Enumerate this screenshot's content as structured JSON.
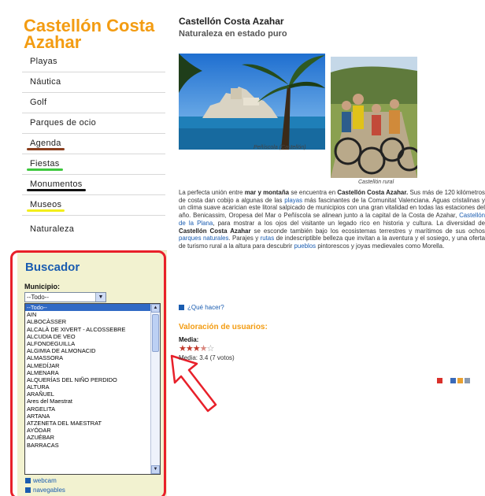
{
  "site": {
    "title": "Castellón Costa Azahar"
  },
  "nav": {
    "items": [
      {
        "label": "Playas"
      },
      {
        "label": "Náutica"
      },
      {
        "label": "Golf"
      },
      {
        "label": "Parques de ocio"
      },
      {
        "label": "Agenda"
      },
      {
        "label": "Fiestas"
      },
      {
        "label": "Monumentos"
      },
      {
        "label": "Museos"
      },
      {
        "label": "Naturaleza"
      }
    ],
    "highlight_colors": [
      "#8b3f1e",
      "#3ec83e",
      "#111111",
      "#f3ee1a"
    ]
  },
  "buscador": {
    "title": "Buscador",
    "municipio_label": "Municipio:",
    "selected": "--Todo--",
    "options": [
      "--Todo--",
      "AIN",
      "ALBOCÀSSER",
      "ALCALÀ DE XIVERT - ALCOSSEBRE",
      "ALCUDIA DE VEO",
      "ALFONDEGUILLA",
      "ALGIMIA DE ALMONACID",
      "ALMASSORA",
      "ALMEDÍJAR",
      "ALMENARA",
      "ALQUERÍAS DEL NIÑO PERDIDO",
      "ALTURA",
      "ARAÑUEL",
      "Ares del Maestrat",
      "ARGELITA",
      "ARTANA",
      "ATZENETA DEL MAESTRAT",
      "AYÓDAR",
      "AZUÉBAR",
      "BARRACAS"
    ],
    "links": [
      "webcam",
      "navegables"
    ],
    "annotation_color": "#e8202a"
  },
  "main": {
    "title": "Castellón Costa Azahar",
    "subtitle": "Naturaleza en estado puro",
    "photo1_caption": "Peñíscola (Castellón)",
    "photo2_caption": "Castellón rural",
    "paragraph": [
      {
        "t": "La perfecta unión entre "
      },
      {
        "b": "mar y montaña"
      },
      {
        "t": " se encuentra en "
      },
      {
        "b": "Castellón Costa Azahar."
      },
      {
        "t": " Sus más de 120 kilómetros de costa dan cobijo a algunas de las "
      },
      {
        "l": "playas"
      },
      {
        "t": " más fascinantes de la Comunitat Valenciana. Aguas cristalinas y un clima suave acarician este litoral salpicado de municipios con una gran vitalidad en todas las estaciones del año. Benicassim, Oropesa del Mar o Peñíscola se alinean junto a la capital de la Costa de Azahar, "
      },
      {
        "l": "Castellón de la Plana"
      },
      {
        "t": ", para mostrar a los ojos del visitante un legado rico en historia y cultura. La diversidad de "
      },
      {
        "b": "Castellón Costa Azahar"
      },
      {
        "t": " se esconde también bajo los ecosistemas terrestres y marítimos de sus ochos "
      },
      {
        "l": "parques naturales"
      },
      {
        "t": ". Parajes y "
      },
      {
        "l": "rutas"
      },
      {
        "t": " de indescriptible belleza que invitan a la aventura y el sosiego, y una oferta de turismo rural a la altura para descubrir "
      },
      {
        "l": "pueblos"
      },
      {
        "t": " pintorescos y joyas medievales como Morella."
      }
    ],
    "que_hacer": "¿Qué hacer?",
    "valoracion_title": "Valoración de usuarios:",
    "media_label": "Media:",
    "rating": {
      "value": 3.4,
      "votes": 7,
      "stars_max": 5
    },
    "media_text": "Media: 3.4 (7 votos)"
  }
}
